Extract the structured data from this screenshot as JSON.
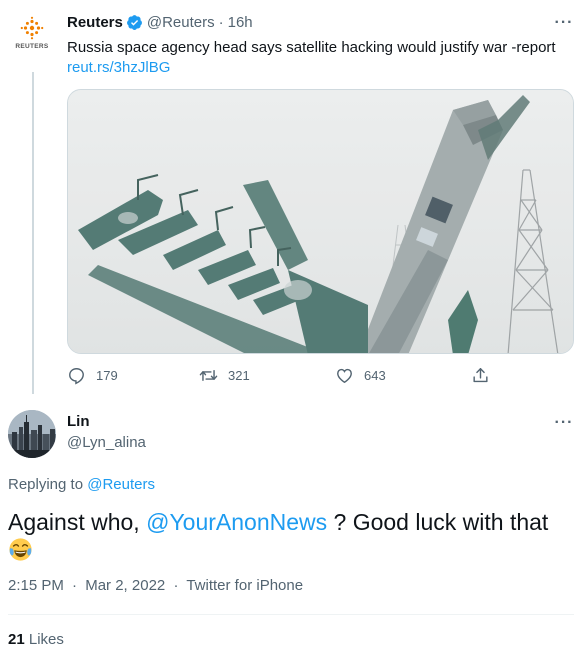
{
  "quoted_tweet": {
    "avatar_brand": "REUTERS",
    "name": "Reuters",
    "handle": "@Reuters",
    "time": "16h",
    "text": "Russia space agency head says satellite hacking would justify war -report",
    "link": "reut.rs/3hzJlBG",
    "replies": "179",
    "retweets": "321",
    "likes": "643",
    "more": "···"
  },
  "reply_tweet": {
    "name": "Lin",
    "handle": "@Lyn_alina",
    "more": "···",
    "replying_prefix": "Replying to ",
    "replying_to": "@Reuters",
    "text_before": "Against who, ",
    "mention": "@YourAnonNews",
    "text_after": " ? Good luck with that",
    "time": "2:15 PM",
    "date": "Mar 2, 2022",
    "source": "Twitter for iPhone",
    "like_count": "21",
    "like_label": "Likes"
  },
  "colors": {
    "accent": "#1d9bf0",
    "muted": "#536471",
    "text": "#0f1419",
    "reuters_orange": "#f08000"
  }
}
